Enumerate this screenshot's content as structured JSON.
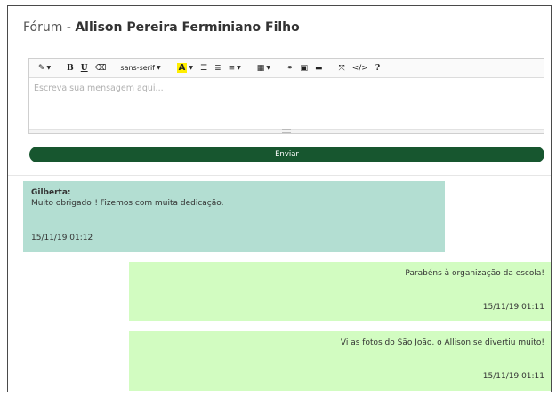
{
  "forum": {
    "title_prefix": "Fórum -",
    "title_name": "Allison Pereira Ferminiano Filho"
  },
  "editor": {
    "toolbar": {
      "magic": "✎",
      "bold": "B",
      "underline": "U",
      "eraser": "⌫",
      "font": "sans-serif",
      "highlight": "A",
      "ul": "☰",
      "ol": "≣",
      "align": "≡",
      "table": "▦",
      "link": "⚭",
      "picture": "▣",
      "video": "▬",
      "fullscreen": "⤧",
      "code": "</>",
      "help": "?"
    },
    "placeholder": "Escreva sua mensagem aqui..."
  },
  "send_label": "Enviar",
  "messages": [
    {
      "author": "Gilberta:",
      "text": "Muito obrigado!! Fizemos com muita dedicação.",
      "time": "15/11/19 01:12"
    },
    {
      "text": "Parabéns à organização da escola!",
      "time": "15/11/19 01:11"
    },
    {
      "text": "Vi as fotos do São João, o Allison se divertiu muito!",
      "time": "15/11/19 01:11"
    }
  ],
  "colors": {
    "send_button": "#17562f",
    "message_received": "#b3ded2",
    "message_sent": "#d2fcc1",
    "highlight": "#ffee00"
  }
}
